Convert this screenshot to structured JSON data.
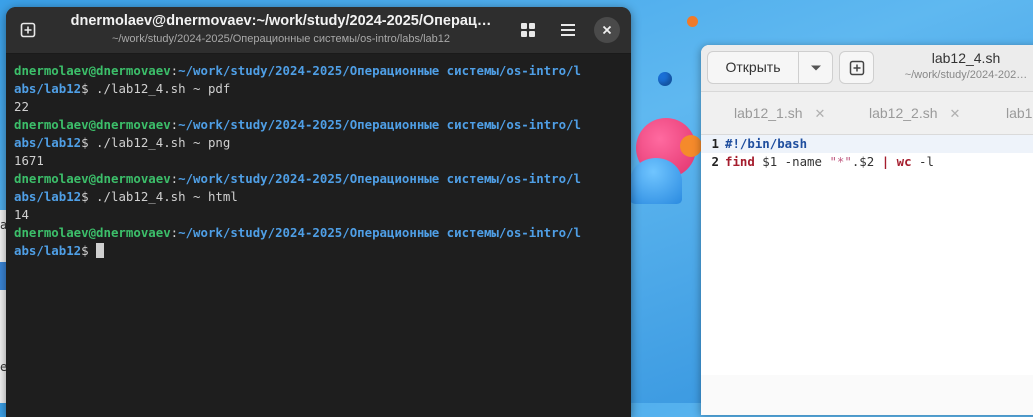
{
  "terminal": {
    "title": "dnermolaev@dnermovaev:~/work/study/2024-2025/Операц…",
    "subtitle": "~/work/study/2024-2025/Операционные системы/os-intro/labs/lab12",
    "lines": [
      {
        "prompt": "dnermolaev@dnermovaev",
        "sep": ":",
        "path": "~/work/study/2024-2025/Операционные системы/os-intro/l"
      },
      {
        "path": "abs/lab12",
        "tail": "$ ./lab12_4.sh ~ pdf"
      },
      {
        "output": "22"
      },
      {
        "prompt": "dnermolaev@dnermovaev",
        "sep": ":",
        "path": "~/work/study/2024-2025/Операционные системы/os-intro/l"
      },
      {
        "path": "abs/lab12",
        "tail": "$ ./lab12_4.sh ~ png"
      },
      {
        "output": "1671"
      },
      {
        "prompt": "dnermolaev@dnermovaev",
        "sep": ":",
        "path": "~/work/study/2024-2025/Операционные системы/os-intro/l"
      },
      {
        "path": "abs/lab12",
        "tail": "$ ./lab12_4.sh ~ html"
      },
      {
        "output": "14"
      },
      {
        "prompt": "dnermolaev@dnermovaev",
        "sep": ":",
        "path": "~/work/study/2024-2025/Операционные системы/os-intro/l"
      },
      {
        "path": "abs/lab12",
        "tail": "$ "
      }
    ]
  },
  "editor": {
    "open_label": "Открыть",
    "title": "lab12_4.sh",
    "subtitle": "~/work/study/2024-202…",
    "tabs": [
      {
        "label": "lab12_1.sh"
      },
      {
        "label": "lab12_2.sh"
      },
      {
        "label": "lab1"
      }
    ],
    "code": {
      "line1": {
        "num": "1",
        "text": "#!/bin/bash"
      },
      "line2": {
        "num": "2",
        "find": "find",
        "a": " $1 -name ",
        "str": "\"*\"",
        "b": ".$2 ",
        "pipe": "|",
        "c": " ",
        "wc": "wc",
        "d": " -l"
      }
    }
  },
  "left_window": {
    "letter_top": "a",
    "letter_bottom": "e"
  }
}
